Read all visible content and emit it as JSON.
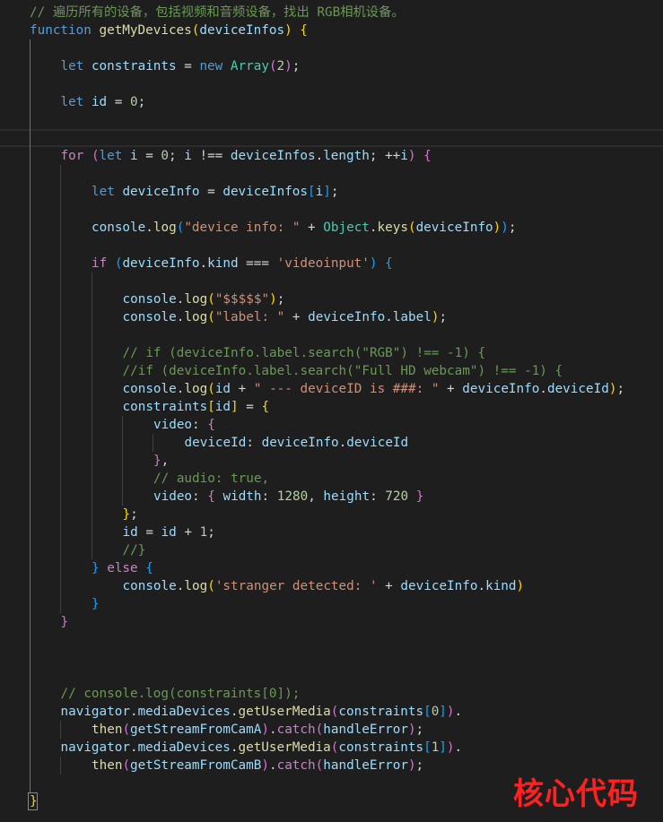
{
  "lines": [
    {
      "row": 0,
      "indent": 0,
      "tokens": [
        [
          "c-com",
          "// 遍历所有的设备，包括视频和音频设备，找出 RGB相机设备。"
        ]
      ]
    },
    {
      "row": 1,
      "indent": 0,
      "tokens": [
        [
          "c-kw",
          "function"
        ],
        [
          "c-pun",
          " "
        ],
        [
          "c-fn",
          "getMyDevices"
        ],
        [
          "b1",
          "("
        ],
        [
          "c-var",
          "deviceInfos"
        ],
        [
          "b1",
          ")"
        ],
        [
          "c-pun",
          " "
        ],
        [
          "b1",
          "{"
        ]
      ]
    },
    {
      "row": 3,
      "indent": 1,
      "tokens": [
        [
          "c-kw",
          "let"
        ],
        [
          "c-pun",
          " "
        ],
        [
          "c-var",
          "constraints"
        ],
        [
          "c-pun",
          " = "
        ],
        [
          "c-kw",
          "new"
        ],
        [
          "c-pun",
          " "
        ],
        [
          "c-cls",
          "Array"
        ],
        [
          "b2",
          "("
        ],
        [
          "c-num",
          "2"
        ],
        [
          "b2",
          ")"
        ],
        [
          "c-pun",
          ";"
        ]
      ]
    },
    {
      "row": 5,
      "indent": 1,
      "tokens": [
        [
          "c-kw",
          "let"
        ],
        [
          "c-pun",
          " "
        ],
        [
          "c-var",
          "id"
        ],
        [
          "c-pun",
          " = "
        ],
        [
          "c-num",
          "0"
        ],
        [
          "c-pun",
          ";"
        ]
      ]
    },
    {
      "row": 8,
      "indent": 1,
      "tokens": [
        [
          "c-ctl",
          "for"
        ],
        [
          "c-pun",
          " "
        ],
        [
          "b2",
          "("
        ],
        [
          "c-kw",
          "let"
        ],
        [
          "c-pun",
          " "
        ],
        [
          "c-var",
          "i"
        ],
        [
          "c-pun",
          " = "
        ],
        [
          "c-num",
          "0"
        ],
        [
          "c-pun",
          "; "
        ],
        [
          "c-var",
          "i"
        ],
        [
          "c-pun",
          " !== "
        ],
        [
          "c-var",
          "deviceInfos"
        ],
        [
          "c-pun",
          "."
        ],
        [
          "c-var",
          "length"
        ],
        [
          "c-pun",
          "; ++"
        ],
        [
          "c-var",
          "i"
        ],
        [
          "b2",
          ")"
        ],
        [
          "c-pun",
          " "
        ],
        [
          "b2",
          "{"
        ]
      ]
    },
    {
      "row": 10,
      "indent": 2,
      "tokens": [
        [
          "c-kw",
          "let"
        ],
        [
          "c-pun",
          " "
        ],
        [
          "c-var",
          "deviceInfo"
        ],
        [
          "c-pun",
          " = "
        ],
        [
          "c-var",
          "deviceInfos"
        ],
        [
          "b3",
          "["
        ],
        [
          "c-var",
          "i"
        ],
        [
          "b3",
          "]"
        ],
        [
          "c-pun",
          ";"
        ]
      ]
    },
    {
      "row": 12,
      "indent": 2,
      "tokens": [
        [
          "c-var",
          "console"
        ],
        [
          "c-pun",
          "."
        ],
        [
          "c-fn",
          "log"
        ],
        [
          "b3",
          "("
        ],
        [
          "c-str",
          "\"device info: \""
        ],
        [
          "c-pun",
          " + "
        ],
        [
          "c-cls",
          "Object"
        ],
        [
          "c-pun",
          "."
        ],
        [
          "c-fn",
          "keys"
        ],
        [
          "b1",
          "("
        ],
        [
          "c-var",
          "deviceInfo"
        ],
        [
          "b1",
          ")"
        ],
        [
          "b3",
          ")"
        ],
        [
          "c-pun",
          ";"
        ]
      ]
    },
    {
      "row": 14,
      "indent": 2,
      "tokens": [
        [
          "c-ctl",
          "if"
        ],
        [
          "c-pun",
          " "
        ],
        [
          "b3",
          "("
        ],
        [
          "c-var",
          "deviceInfo"
        ],
        [
          "c-pun",
          "."
        ],
        [
          "c-var",
          "kind"
        ],
        [
          "c-pun",
          " === "
        ],
        [
          "c-str",
          "'videoinput'"
        ],
        [
          "b3",
          ")"
        ],
        [
          "c-pun",
          " "
        ],
        [
          "b3",
          "{"
        ]
      ]
    },
    {
      "row": 16,
      "indent": 3,
      "tokens": [
        [
          "c-var",
          "console"
        ],
        [
          "c-pun",
          "."
        ],
        [
          "c-fn",
          "log"
        ],
        [
          "b1",
          "("
        ],
        [
          "c-str",
          "\"$$$$$\""
        ],
        [
          "b1",
          ")"
        ],
        [
          "c-pun",
          ";"
        ]
      ]
    },
    {
      "row": 17,
      "indent": 3,
      "tokens": [
        [
          "c-var",
          "console"
        ],
        [
          "c-pun",
          "."
        ],
        [
          "c-fn",
          "log"
        ],
        [
          "b1",
          "("
        ],
        [
          "c-str",
          "\"label: \""
        ],
        [
          "c-pun",
          " + "
        ],
        [
          "c-var",
          "deviceInfo"
        ],
        [
          "c-pun",
          "."
        ],
        [
          "c-var",
          "label"
        ],
        [
          "b1",
          ")"
        ],
        [
          "c-pun",
          ";"
        ]
      ]
    },
    {
      "row": 19,
      "indent": 3,
      "tokens": [
        [
          "c-com",
          "// if (deviceInfo.label.search(\"RGB\") !== -1) {"
        ]
      ]
    },
    {
      "row": 20,
      "indent": 3,
      "tokens": [
        [
          "c-com",
          "//if (deviceInfo.label.search(\"Full HD webcam\") !== -1) {"
        ]
      ]
    },
    {
      "row": 21,
      "indent": 3,
      "tokens": [
        [
          "c-var",
          "console"
        ],
        [
          "c-pun",
          "."
        ],
        [
          "c-fn",
          "log"
        ],
        [
          "b1",
          "("
        ],
        [
          "c-var",
          "id"
        ],
        [
          "c-pun",
          " + "
        ],
        [
          "c-str",
          "\" --- deviceID is ###: \""
        ],
        [
          "c-pun",
          " + "
        ],
        [
          "c-var",
          "deviceInfo"
        ],
        [
          "c-pun",
          "."
        ],
        [
          "c-var",
          "deviceId"
        ],
        [
          "b1",
          ")"
        ],
        [
          "c-pun",
          ";"
        ]
      ]
    },
    {
      "row": 22,
      "indent": 3,
      "tokens": [
        [
          "c-var",
          "constraints"
        ],
        [
          "b1",
          "["
        ],
        [
          "c-var",
          "id"
        ],
        [
          "b1",
          "]"
        ],
        [
          "c-pun",
          " = "
        ],
        [
          "b1",
          "{"
        ]
      ]
    },
    {
      "row": 23,
      "indent": 4,
      "tokens": [
        [
          "c-var",
          "video"
        ],
        [
          "c-pun",
          ": "
        ],
        [
          "b2",
          "{"
        ]
      ]
    },
    {
      "row": 24,
      "indent": 5,
      "tokens": [
        [
          "c-var",
          "deviceId"
        ],
        [
          "c-pun",
          ": "
        ],
        [
          "c-var",
          "deviceInfo"
        ],
        [
          "c-pun",
          "."
        ],
        [
          "c-var",
          "deviceId"
        ]
      ]
    },
    {
      "row": 25,
      "indent": 4,
      "tokens": [
        [
          "b2",
          "}"
        ],
        [
          "c-pun",
          ","
        ]
      ]
    },
    {
      "row": 26,
      "indent": 4,
      "tokens": [
        [
          "c-com",
          "// audio: true,"
        ]
      ]
    },
    {
      "row": 27,
      "indent": 4,
      "tokens": [
        [
          "c-var",
          "video"
        ],
        [
          "c-pun",
          ": "
        ],
        [
          "b2",
          "{"
        ],
        [
          "c-pun",
          " "
        ],
        [
          "c-var",
          "width"
        ],
        [
          "c-pun",
          ": "
        ],
        [
          "c-num",
          "1280"
        ],
        [
          "c-pun",
          ", "
        ],
        [
          "c-var",
          "height"
        ],
        [
          "c-pun",
          ": "
        ],
        [
          "c-num",
          "720"
        ],
        [
          "c-pun",
          " "
        ],
        [
          "b2",
          "}"
        ]
      ]
    },
    {
      "row": 28,
      "indent": 3,
      "tokens": [
        [
          "b1",
          "}"
        ],
        [
          "c-pun",
          ";"
        ]
      ]
    },
    {
      "row": 29,
      "indent": 3,
      "tokens": [
        [
          "c-var",
          "id"
        ],
        [
          "c-pun",
          " = "
        ],
        [
          "c-var",
          "id"
        ],
        [
          "c-pun",
          " + "
        ],
        [
          "c-num",
          "1"
        ],
        [
          "c-pun",
          ";"
        ]
      ]
    },
    {
      "row": 30,
      "indent": 3,
      "tokens": [
        [
          "c-com",
          "//}"
        ]
      ]
    },
    {
      "row": 31,
      "indent": 2,
      "tokens": [
        [
          "b3",
          "}"
        ],
        [
          "c-pun",
          " "
        ],
        [
          "c-ctl",
          "else"
        ],
        [
          "c-pun",
          " "
        ],
        [
          "b3",
          "{"
        ]
      ]
    },
    {
      "row": 32,
      "indent": 3,
      "tokens": [
        [
          "c-var",
          "console"
        ],
        [
          "c-pun",
          "."
        ],
        [
          "c-fn",
          "log"
        ],
        [
          "b1",
          "("
        ],
        [
          "c-str",
          "'stranger detected: '"
        ],
        [
          "c-pun",
          " + "
        ],
        [
          "c-var",
          "deviceInfo"
        ],
        [
          "c-pun",
          "."
        ],
        [
          "c-var",
          "kind"
        ],
        [
          "b1",
          ")"
        ]
      ]
    },
    {
      "row": 33,
      "indent": 2,
      "tokens": [
        [
          "b3",
          "}"
        ]
      ]
    },
    {
      "row": 34,
      "indent": 1,
      "tokens": [
        [
          "b2",
          "}"
        ]
      ]
    },
    {
      "row": 38,
      "indent": 1,
      "tokens": [
        [
          "c-com",
          "// console.log(constraints[0]);"
        ]
      ]
    },
    {
      "row": 39,
      "indent": 1,
      "tokens": [
        [
          "c-var",
          "navigator"
        ],
        [
          "c-pun",
          "."
        ],
        [
          "c-var",
          "mediaDevices"
        ],
        [
          "c-pun",
          "."
        ],
        [
          "c-fn",
          "getUserMedia"
        ],
        [
          "b2",
          "("
        ],
        [
          "c-var",
          "constraints"
        ],
        [
          "b3",
          "["
        ],
        [
          "c-num",
          "0"
        ],
        [
          "b3",
          "]"
        ],
        [
          "b2",
          ")"
        ],
        [
          "c-pun",
          "."
        ]
      ]
    },
    {
      "row": 40,
      "indent": 2,
      "tokens": [
        [
          "c-fn",
          "then"
        ],
        [
          "b2",
          "("
        ],
        [
          "c-var",
          "getStreamFromCamA"
        ],
        [
          "b2",
          ")"
        ],
        [
          "c-pun",
          "."
        ],
        [
          "c-ctl",
          "catch"
        ],
        [
          "b2",
          "("
        ],
        [
          "c-var",
          "handleError"
        ],
        [
          "b2",
          ")"
        ],
        [
          "c-pun",
          ";"
        ]
      ]
    },
    {
      "row": 41,
      "indent": 1,
      "tokens": [
        [
          "c-var",
          "navigator"
        ],
        [
          "c-pun",
          "."
        ],
        [
          "c-var",
          "mediaDevices"
        ],
        [
          "c-pun",
          "."
        ],
        [
          "c-fn",
          "getUserMedia"
        ],
        [
          "b2",
          "("
        ],
        [
          "c-var",
          "constraints"
        ],
        [
          "b3",
          "["
        ],
        [
          "c-num",
          "1"
        ],
        [
          "b3",
          "]"
        ],
        [
          "b2",
          ")"
        ],
        [
          "c-pun",
          "."
        ]
      ]
    },
    {
      "row": 42,
      "indent": 2,
      "tokens": [
        [
          "c-fn",
          "then"
        ],
        [
          "b2",
          "("
        ],
        [
          "c-var",
          "getStreamFromCamB"
        ],
        [
          "b2",
          ")"
        ],
        [
          "c-pun",
          "."
        ],
        [
          "c-ctl",
          "catch"
        ],
        [
          "b2",
          "("
        ],
        [
          "c-var",
          "handleError"
        ],
        [
          "b2",
          ")"
        ],
        [
          "c-pun",
          ";"
        ]
      ]
    }
  ],
  "closing_brace": "}",
  "watermark": "核心代码"
}
